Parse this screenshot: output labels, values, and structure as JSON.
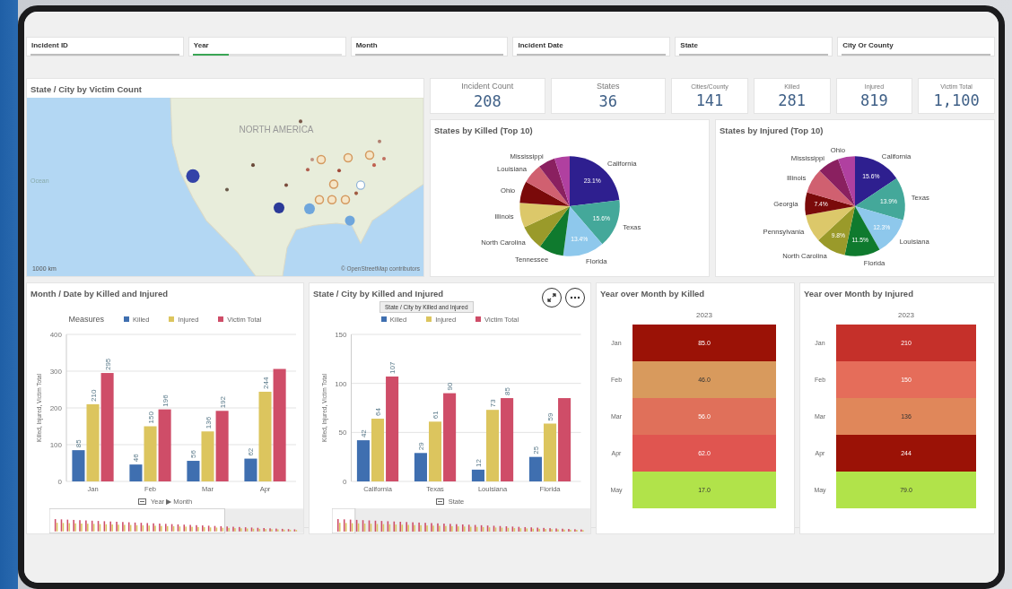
{
  "filters": [
    {
      "label": "Incident ID",
      "selected": false
    },
    {
      "label": "Year",
      "selected": true
    },
    {
      "label": "Month",
      "selected": false
    },
    {
      "label": "Incident Date",
      "selected": false
    },
    {
      "label": "State",
      "selected": false
    },
    {
      "label": "City Or County",
      "selected": false
    }
  ],
  "map_panel": {
    "title": "State / City by Victim Count",
    "region_label": "NORTH AMERICA",
    "ocean_label": "Ocean",
    "scale": "1000 km",
    "attribution": "© OpenStreetMap contributors"
  },
  "kpis": [
    {
      "label": "Incident Count",
      "value": "208"
    },
    {
      "label": "States",
      "value": "36"
    },
    {
      "label": "Cities/County",
      "value": "141"
    },
    {
      "label": "Killed",
      "value": "281"
    },
    {
      "label": "Injured",
      "value": "819"
    },
    {
      "label": "Victim Total",
      "value": "1,100"
    }
  ],
  "pies": [
    {
      "title": "States by Killed (Top 10)",
      "chart_data": {
        "type": "pie",
        "categories": [
          "California",
          "Texas",
          "Florida",
          "Tennessee",
          "North Carolina",
          "Illinois",
          "Ohio",
          "Louisiana",
          "Mississippi",
          null
        ],
        "values": [
          23.1,
          15.6,
          13.4,
          8,
          8,
          8,
          7,
          6.5,
          5.5,
          4.9
        ],
        "colors": [
          "#2e1f8f",
          "#44a89a",
          "#8ec8ec",
          "#0f7a2e",
          "#9a9a2a",
          "#dcc86a",
          "#7a0a0a",
          "#d06070",
          "#8a2060",
          "#b040a0"
        ],
        "value_labels": [
          "23.1%",
          "15.6%",
          "13.4%",
          null,
          null,
          null,
          null,
          null,
          null,
          null
        ]
      }
    },
    {
      "title": "States by Injured (Top 10)",
      "chart_data": {
        "type": "pie",
        "categories": [
          "California",
          "Texas",
          "Louisiana",
          "Florida",
          "North Carolina",
          "Pennsylvania",
          "Georgia",
          "Illinois",
          "Mississippi",
          "Ohio"
        ],
        "values": [
          15.6,
          13.9,
          12.3,
          11.5,
          9.8,
          9,
          7.4,
          8,
          7,
          5.5
        ],
        "colors": [
          "#2e1f8f",
          "#44a89a",
          "#8ec8ec",
          "#0f7a2e",
          "#9a9a2a",
          "#dcc86a",
          "#7a0a0a",
          "#d06070",
          "#8a2060",
          "#b040a0"
        ],
        "value_labels": [
          "15.6%",
          "13.9%",
          "12.3%",
          "11.5%",
          "9.8%",
          null,
          "7.4%",
          null,
          null,
          null
        ]
      }
    }
  ],
  "bar_panels": [
    {
      "title": "Month / Date by Killed and Injured",
      "legend_title": "Measures",
      "toolbar": false,
      "chart_data": {
        "type": "bar",
        "ylabel": "Killed, Injured, Victim Total",
        "xlabel": "Year ▶ Month",
        "grid": true,
        "categories": [
          "Jan",
          "Feb",
          "Mar",
          "Apr"
        ],
        "ylim": [
          0,
          400
        ],
        "yticks": [
          0,
          100,
          200,
          300,
          400
        ],
        "series": [
          {
            "name": "Killed",
            "color": "#3f6fb0",
            "values": [
              85,
              46,
              56,
              62
            ],
            "value_labels": [
              "85",
              "46",
              "56",
              "62"
            ]
          },
          {
            "name": "Injured",
            "color": "#dcc55e",
            "values": [
              210,
              150,
              136,
              244
            ],
            "value_labels": [
              "210",
              "150",
              "136",
              "244"
            ]
          },
          {
            "name": "Victim Total",
            "color": "#cf4d68",
            "values": [
              295,
              196,
              192,
              306
            ],
            "value_labels": [
              "295",
              "196",
              "192",
              null
            ]
          }
        ]
      }
    },
    {
      "title": "State / City by Killed and Injured",
      "tooltip": "State / City by Killed and Injured",
      "toolbar": true,
      "chart_data": {
        "type": "bar",
        "ylabel": "Killed, Injured, Victim Total",
        "xlabel": "State",
        "grid": true,
        "categories": [
          "California",
          "Texas",
          "Louisiana",
          "Florida"
        ],
        "ylim": [
          0,
          150
        ],
        "yticks": [
          0,
          50,
          100,
          150
        ],
        "series": [
          {
            "name": "Killed",
            "color": "#3f6fb0",
            "values": [
              42,
              29,
              12,
              25
            ],
            "value_labels": [
              "42",
              "29",
              "12",
              "25"
            ]
          },
          {
            "name": "Injured",
            "color": "#dcc55e",
            "values": [
              64,
              61,
              73,
              59
            ],
            "value_labels": [
              "64",
              "61",
              "73",
              "59"
            ]
          },
          {
            "name": "Victim Total",
            "color": "#cf4d68",
            "values": [
              107,
              90,
              85,
              85
            ],
            "value_labels": [
              "107",
              "90",
              "85",
              null
            ]
          }
        ]
      }
    }
  ],
  "heatmaps": [
    {
      "title": "Year over Month by Killed",
      "column": "2023",
      "rows": [
        {
          "label": "Jan",
          "value": "85.0",
          "color": "#9b1206"
        },
        {
          "label": "Feb",
          "value": "46.0",
          "color": "#d89a5d"
        },
        {
          "label": "Mar",
          "value": "56.0",
          "color": "#e0705a"
        },
        {
          "label": "Apr",
          "value": "62.0",
          "color": "#e05550"
        },
        {
          "label": "May",
          "value": "17.0",
          "color": "#b1e34a"
        }
      ]
    },
    {
      "title": "Year over Month by Injured",
      "column": "2023",
      "rows": [
        {
          "label": "Jan",
          "value": "210",
          "color": "#c5302a"
        },
        {
          "label": "Feb",
          "value": "150",
          "color": "#e56d5a"
        },
        {
          "label": "Mar",
          "value": "136",
          "color": "#e0875a"
        },
        {
          "label": "Apr",
          "value": "244",
          "color": "#9b1206"
        },
        {
          "label": "May",
          "value": "79.0",
          "color": "#b1e34a"
        }
      ]
    }
  ]
}
